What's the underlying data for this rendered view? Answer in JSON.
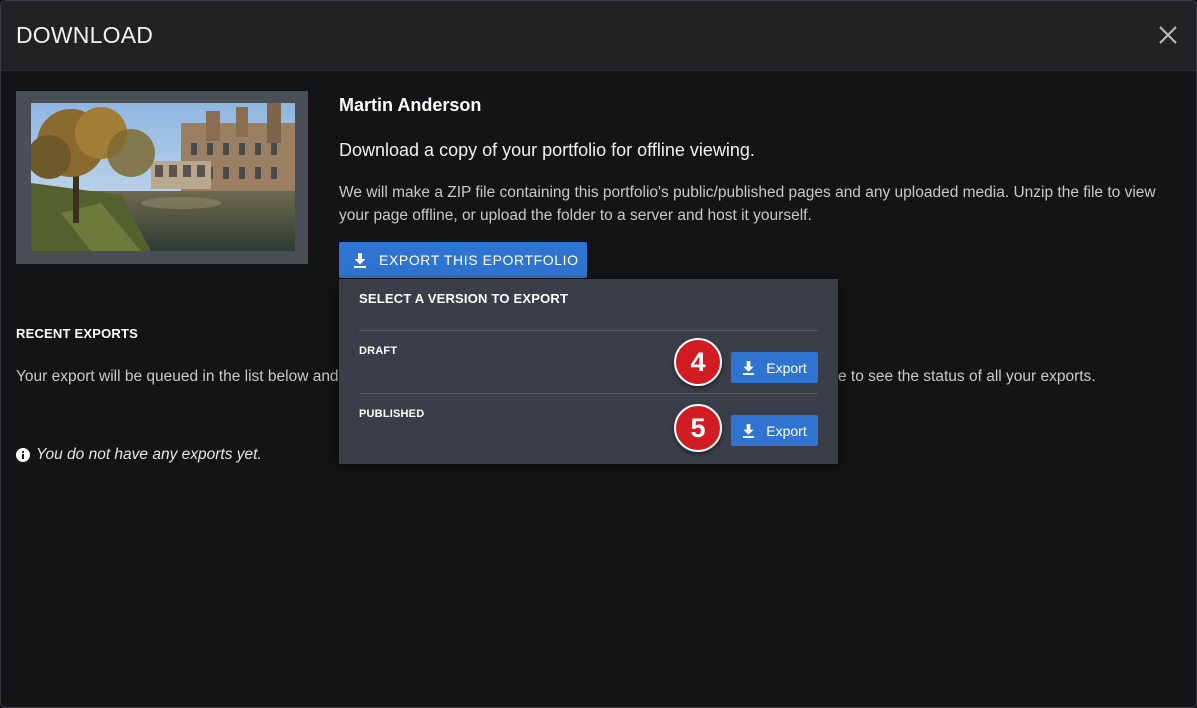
{
  "modal": {
    "title": "DOWNLOAD",
    "close_icon": "close-icon"
  },
  "portfolio": {
    "owner_name": "Martin Anderson",
    "lead": "Download a copy of your portfolio for offline viewing.",
    "description": "We will make a ZIP file containing this portfolio's public/published pages and any uploaded media. Unzip the file to view your page offline, or upload the folder to a server and host it yourself.",
    "thumbnail_icon": "portfolio-thumbnail-image",
    "export_button_label": "EXPORT THIS EPORTFOLIO"
  },
  "export_menu": {
    "title": "SELECT A VERSION TO EXPORT",
    "options": [
      {
        "label": "DRAFT",
        "button_label": "Export",
        "step": "4"
      },
      {
        "label": "PUBLISHED",
        "button_label": "Export",
        "step": "5"
      }
    ]
  },
  "recent_exports": {
    "title": "RECENT EXPORTS",
    "queue_text_left": "Your export will be queued in the list below and processed in the background. Come back here later or reload the page",
    "queue_text_right": "e to see the status of all your exports.",
    "empty_message": "You do not have any exports yet."
  },
  "colors": {
    "accent": "#2f74d0",
    "badge": "#d11c23",
    "menu_bg": "#3a3e49",
    "header_bg": "#222224"
  }
}
